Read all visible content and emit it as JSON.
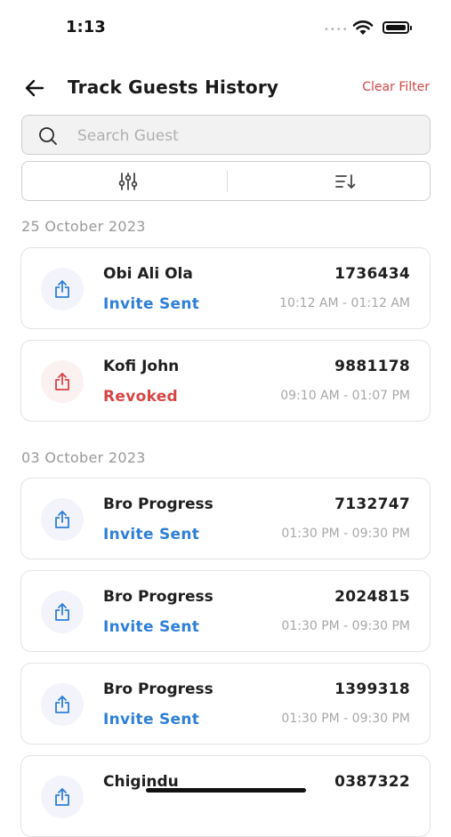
{
  "status_bar": {
    "time": "1:13",
    "signal": "••••"
  },
  "header": {
    "title": "Track Guests History",
    "clear_filter": "Clear Filter"
  },
  "search": {
    "placeholder": "Search Guest",
    "value": ""
  },
  "colors": {
    "accent_blue": "#2e7fd6",
    "revoked_red": "#d64545",
    "muted_text": "#a8a8a8"
  },
  "icons": {
    "back": "arrow-left-icon",
    "search": "search-icon",
    "filter": "sliders-icon",
    "sort": "sort-icon",
    "share": "share-upload-icon"
  },
  "groups": [
    {
      "date": "25 October 2023",
      "entries": [
        {
          "name": "Obi Ali Ola",
          "status": "Invite Sent",
          "code": "1736434",
          "time": "10:12 AM - 01:12 AM"
        },
        {
          "name": "Kofi John",
          "status": "Revoked",
          "code": "9881178",
          "time": "09:10 AM - 01:07 PM"
        }
      ]
    },
    {
      "date": "03 October 2023",
      "entries": [
        {
          "name": "Bro Progress",
          "status": "Invite Sent",
          "code": "7132747",
          "time": "01:30 PM - 09:30 PM"
        },
        {
          "name": "Bro Progress",
          "status": "Invite Sent",
          "code": "2024815",
          "time": "01:30 PM - 09:30 PM"
        },
        {
          "name": "Bro Progress",
          "status": "Invite Sent",
          "code": "1399318",
          "time": "01:30 PM - 09:30 PM"
        },
        {
          "name": "Chigindu",
          "status": "",
          "code": "0387322",
          "time": ""
        }
      ]
    }
  ]
}
